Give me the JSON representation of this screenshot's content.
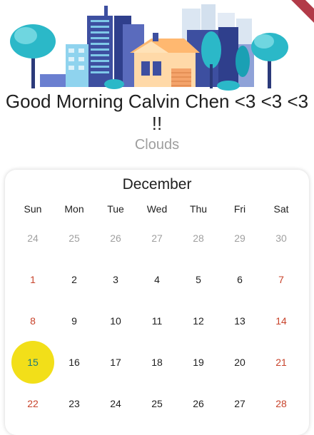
{
  "header": {
    "greeting": "Good Morning Calvin Chen <3 <3 <3 !!",
    "weather": "Clouds"
  },
  "calendar": {
    "month": "December",
    "weekdays": [
      "Sun",
      "Mon",
      "Tue",
      "Wed",
      "Thu",
      "Fri",
      "Sat"
    ],
    "weeks": [
      [
        {
          "d": "24",
          "o": true
        },
        {
          "d": "25",
          "o": true
        },
        {
          "d": "26",
          "o": true
        },
        {
          "d": "27",
          "o": true
        },
        {
          "d": "28",
          "o": true
        },
        {
          "d": "29",
          "o": true
        },
        {
          "d": "30",
          "o": true
        }
      ],
      [
        {
          "d": "1"
        },
        {
          "d": "2"
        },
        {
          "d": "3"
        },
        {
          "d": "4"
        },
        {
          "d": "5"
        },
        {
          "d": "6"
        },
        {
          "d": "7"
        }
      ],
      [
        {
          "d": "8"
        },
        {
          "d": "9"
        },
        {
          "d": "10"
        },
        {
          "d": "11"
        },
        {
          "d": "12"
        },
        {
          "d": "13"
        },
        {
          "d": "14"
        }
      ],
      [
        {
          "d": "15",
          "today": true
        },
        {
          "d": "16"
        },
        {
          "d": "17"
        },
        {
          "d": "18"
        },
        {
          "d": "19"
        },
        {
          "d": "20"
        },
        {
          "d": "21"
        }
      ],
      [
        {
          "d": "22"
        },
        {
          "d": "23"
        },
        {
          "d": "24"
        },
        {
          "d": "25"
        },
        {
          "d": "26"
        },
        {
          "d": "27"
        },
        {
          "d": "28"
        }
      ]
    ]
  },
  "colors": {
    "weekend": "#c8432b",
    "outside_month": "#a0a0a0",
    "today_highlight": "#f2df19",
    "today_text": "#1f7a7a"
  }
}
